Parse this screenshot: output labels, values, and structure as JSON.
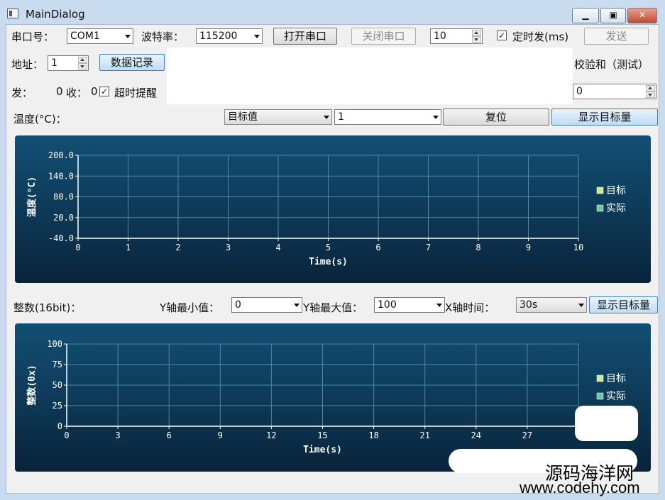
{
  "window": {
    "title": "MainDialog"
  },
  "toolbar": {
    "port_label": "串口号：",
    "port_value": "COM1",
    "baud_label": "波特率：",
    "baud_value": "115200",
    "open_button": "打开串口",
    "close_button": "关闭串口",
    "interval_value": "10",
    "timer_check": "✓",
    "timer_label": "定时发(ms)",
    "send_button": "发送"
  },
  "row2": {
    "address_label": "地址：",
    "address_value": "1",
    "record_button": "数据记录",
    "checksum_label": "校验和（测试）",
    "checksum_value": "0"
  },
  "row3": {
    "send_label": "发：",
    "send_count": "0",
    "recv_label": "收：",
    "recv_count": "0",
    "timeout_check": "✓",
    "timeout_label": "超时提醒"
  },
  "temp_controls": {
    "label": "温度(°C)：",
    "mode_value": "目标值",
    "channel_value": "1",
    "reset_button": "复位",
    "show_target_button": "显示目标量"
  },
  "int_controls": {
    "label": "整数(16bit)：",
    "ymin_label": "Y轴最小值：",
    "ymin_value": "0",
    "ymax_label": "Y轴最大值：",
    "ymax_value": "100",
    "xtime_label": "X轴时间：",
    "xtime_value": "30s",
    "show_target_button": "显示目标量"
  },
  "chart_data": [
    {
      "type": "line",
      "xlabel": "Time(s)",
      "ylabel": "温度(°C)",
      "xlim": [
        0,
        10
      ],
      "ylim": [
        -40,
        200
      ],
      "x_ticks": [
        "0",
        "1",
        "2",
        "3",
        "4",
        "5",
        "6",
        "7",
        "8",
        "9",
        "10"
      ],
      "y_ticks": [
        "200.0",
        "140.0",
        "80.0",
        "20.0",
        "-40.0"
      ],
      "grid": true,
      "legend_position": "right",
      "series": [
        {
          "name": "目标",
          "color": "#c9e89a",
          "values": []
        },
        {
          "name": "实际",
          "color": "#6fc7a0",
          "values": []
        }
      ]
    },
    {
      "type": "line",
      "xlabel": "Time(s)",
      "ylabel": "整数(0x)",
      "xlim": [
        0,
        30
      ],
      "ylim": [
        0,
        100
      ],
      "x_ticks": [
        "0",
        "3",
        "6",
        "9",
        "12",
        "15",
        "18",
        "21",
        "24",
        "27",
        "3"
      ],
      "y_ticks": [
        "100",
        "75",
        "50",
        "25",
        "0"
      ],
      "grid": true,
      "legend_position": "right",
      "series": [
        {
          "name": "目标",
          "color": "#c9e89a",
          "values": []
        },
        {
          "name": "实际",
          "color": "#6fc7a0",
          "values": []
        }
      ]
    }
  ],
  "watermark": {
    "line1": "源码海洋网",
    "line2": "www.codehy.com"
  }
}
